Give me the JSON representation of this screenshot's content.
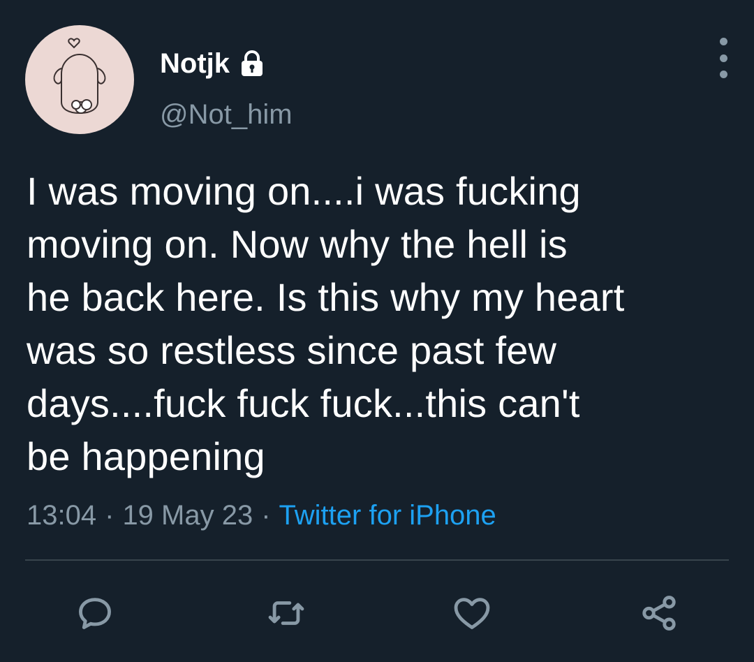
{
  "tweet": {
    "author": {
      "display_name": "Notjk",
      "handle": "@Not_him",
      "avatar_icon": "cute-drawing-avatar",
      "protected_icon": "lock-icon"
    },
    "text": "I was moving on....i was fucking\nmoving on. Now why the hell is\nhe back here. Is this why my heart\nwas so restless since past few\ndays....fuck fuck fuck...this can't\nbe happening",
    "time": "13:04",
    "date": "19 May 23",
    "separator": "·",
    "source": "Twitter for iPhone"
  },
  "actions": [
    {
      "name": "reply-icon"
    },
    {
      "name": "retweet-icon"
    },
    {
      "name": "like-icon"
    },
    {
      "name": "share-icon"
    }
  ],
  "colors": {
    "background": "#15202b",
    "text": "#ffffff",
    "secondary_text": "#8899a6",
    "link": "#1da1f2",
    "divider": "#38444d"
  }
}
